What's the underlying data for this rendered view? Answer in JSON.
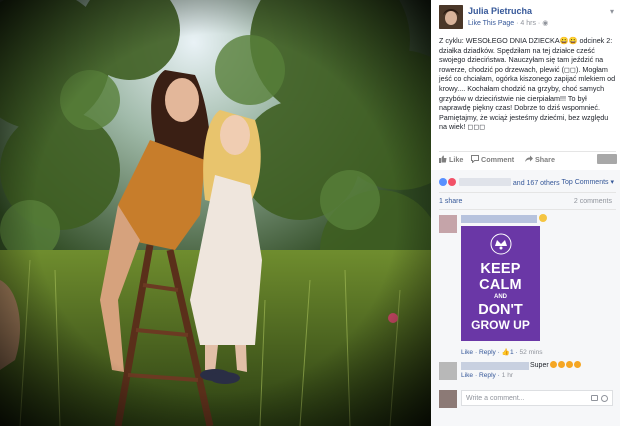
{
  "post": {
    "author": "Julia Pietrucha",
    "like_page": "Like This Page",
    "time": "4 hrs",
    "text": "Z cyklu: WESOŁEGO DNIA DZIECKA😀😀 odcinek 2: działka dziadków. Spędziłam na tej działce cześć swojego dzieciństwa. Nauczyłam się tam jeździć na rowerze, chodzić po drzewach, plewić (◻◻). Mogłam jeść co chciałam, ogórka kiszonego zapijać mlekiem od krowy.... Kochałam chodzić na grzyby, choć samych grzybów w dzieciństwie nie cierpiałam!!! To był naprawdę piękny czas! Dobrze to dziś wspomnieć. Pamiętajmy, że wciąż jesteśmy dziećmi, bez względu na wiek! ◻◻◻"
  },
  "actions": {
    "like": "Like",
    "comment": "Comment",
    "share": "Share"
  },
  "reactions": {
    "others": "and 167 others",
    "top_comments": "Top Comments ▾"
  },
  "stats": {
    "shares": "1 share",
    "comments": "2 comments"
  },
  "comments": [
    {
      "image_text": {
        "line1": "KEEP",
        "line2": "CALM",
        "line3": "AND",
        "line4": "DON'T",
        "line5": "GROW UP"
      },
      "meta": {
        "like": "Like",
        "reply": "Reply",
        "likes": "1",
        "time": "52 mins"
      }
    },
    {
      "text": "Super",
      "meta": {
        "like": "Like",
        "reply": "Reply",
        "time": "1 hr"
      }
    }
  ],
  "composer": {
    "placeholder": "Write a comment..."
  },
  "colors": {
    "link": "#365899",
    "keep_calm_bg": "#6a37a6",
    "facebook_like": "#5890ff",
    "love": "#f25268"
  }
}
